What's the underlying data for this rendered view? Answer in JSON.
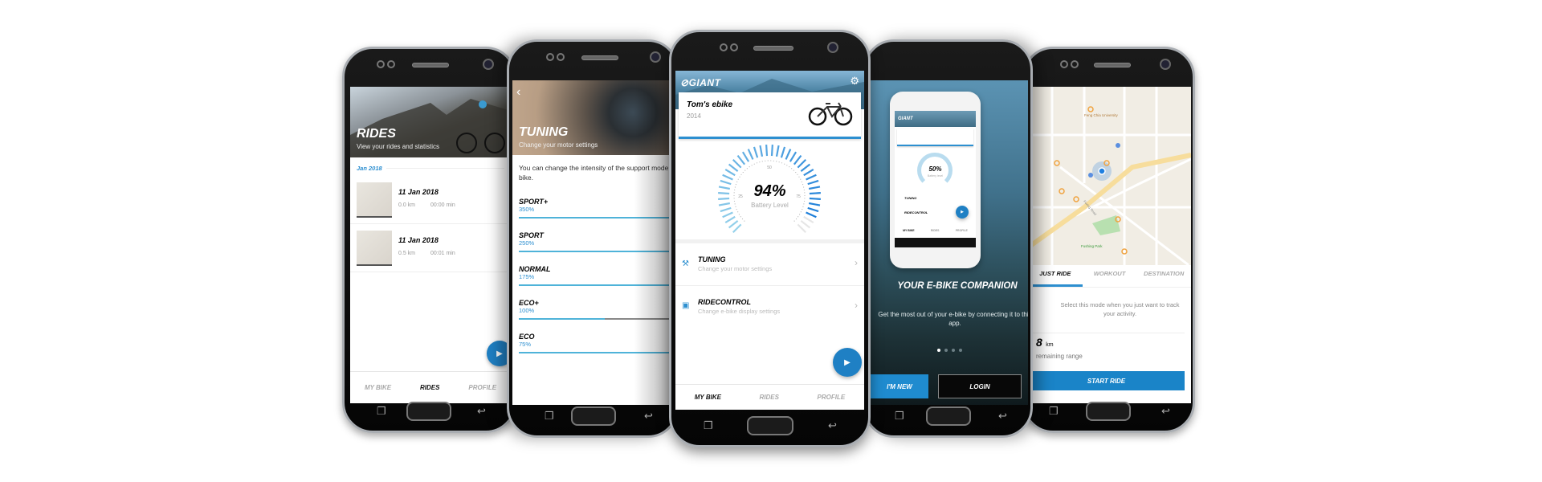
{
  "rides_screen": {
    "title": "RIDES",
    "subtitle": "View your rides and statistics",
    "month": "Jan 2018",
    "rides": [
      {
        "date": "11 Jan 2018",
        "distance": "0.0 km",
        "duration": "00:00 min"
      },
      {
        "date": "11 Jan 2018",
        "distance": "0.5 km",
        "duration": "00:01 min"
      }
    ],
    "nav": [
      "MY BIKE",
      "RIDES",
      "PROFILE"
    ],
    "active_nav": "RIDES",
    "fab_icon": "play-icon"
  },
  "tuning_screen": {
    "title": "TUNING",
    "subtitle": "Change your motor settings",
    "description": "You can change the intensity of the support mode on your e-bike.",
    "modes": [
      {
        "label": "SPORT+",
        "value": "350%",
        "level": 1.0
      },
      {
        "label": "SPORT",
        "value": "250%",
        "level": 1.0
      },
      {
        "label": "NORMAL",
        "value": "175%",
        "level": 1.0
      },
      {
        "label": "ECO+",
        "value": "100%",
        "level": 0.55
      },
      {
        "label": "ECO",
        "value": "75%",
        "level": 1.0
      }
    ]
  },
  "mybike_screen": {
    "logo": "GIANT",
    "bike_name": "Tom's ebike",
    "bike_year": "2014",
    "battery_percent": 94,
    "battery_text": "94%",
    "battery_label": "Battery Level",
    "gauge_ticks": [
      "25",
      "50",
      "75"
    ],
    "menu": [
      {
        "title": "TUNING",
        "subtitle": "Change your motor settings",
        "icon": "wrench-icon"
      },
      {
        "title": "RIDECONTROL",
        "subtitle": "Change e-bike display settings",
        "icon": "display-icon"
      }
    ],
    "nav": [
      "MY BIKE",
      "RIDES",
      "PROFILE"
    ],
    "active_nav": "MY BIKE"
  },
  "onboarding_screen": {
    "mini": {
      "battery": "50%",
      "battery_label": "Battery level",
      "menu": [
        "TUNING",
        "RIDECONTROL"
      ],
      "nav": [
        "MY BIKE",
        "RIDES",
        "PROFILE"
      ]
    },
    "title": "YOUR E-BIKE COMPANION",
    "text": "Get the most out of your e-bike by connecting it to this app.",
    "pages": 4,
    "active_page": 1,
    "new_button": "I'M NEW",
    "login_button": "LOGIN"
  },
  "ride_screen": {
    "map_labels": [
      "Feng Chia University",
      "Fushing Park",
      "Fuxing Road"
    ],
    "tabs": [
      "JUST RIDE",
      "WORKOUT",
      "DESTINATION"
    ],
    "active_tab": "JUST RIDE",
    "description": "Select this mode when you just want to track your activity.",
    "range_value": "8",
    "range_unit": "km",
    "range_label": "remaining range",
    "start_button": "START RIDE"
  },
  "colors": {
    "accent": "#1f80c4",
    "bar": "#4fb3d9"
  }
}
